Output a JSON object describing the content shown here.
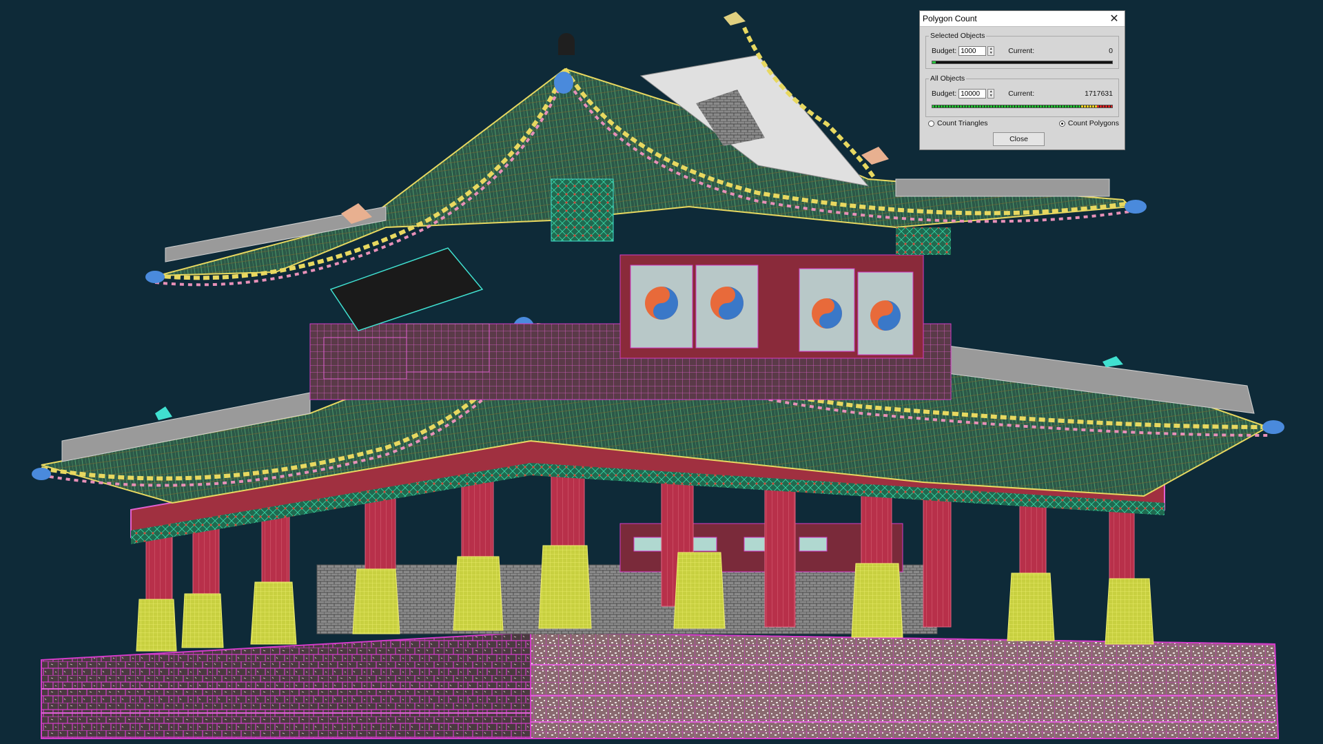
{
  "dialog": {
    "title": "Polygon Count",
    "selected_objects": {
      "legend": "Selected Objects",
      "budget_label": "Budget:",
      "budget_value": "1000",
      "current_label": "Current:",
      "current_value": "0",
      "progress": 0.02
    },
    "all_objects": {
      "legend": "All Objects",
      "budget_label": "Budget:",
      "budget_value": "10000",
      "current_label": "Current:",
      "current_value": "1717631",
      "progress": 1.0
    },
    "count_triangles_label": "Count Triangles",
    "count_polygons_label": "Count Polygons",
    "selected_mode": "Count Polygons",
    "close_label": "Close"
  },
  "scene": {
    "background_color": "#0e2a38",
    "wire_colors": {
      "roof_tiles": "#2f7a5a",
      "roof_edge_yellow": "#e8d860",
      "roof_edge_pink": "#e890b8",
      "columns": "#c23a52",
      "column_bases": "#d8e050",
      "stone_wall": "#d23cc8",
      "trim_cyan": "#40e0d0"
    }
  }
}
